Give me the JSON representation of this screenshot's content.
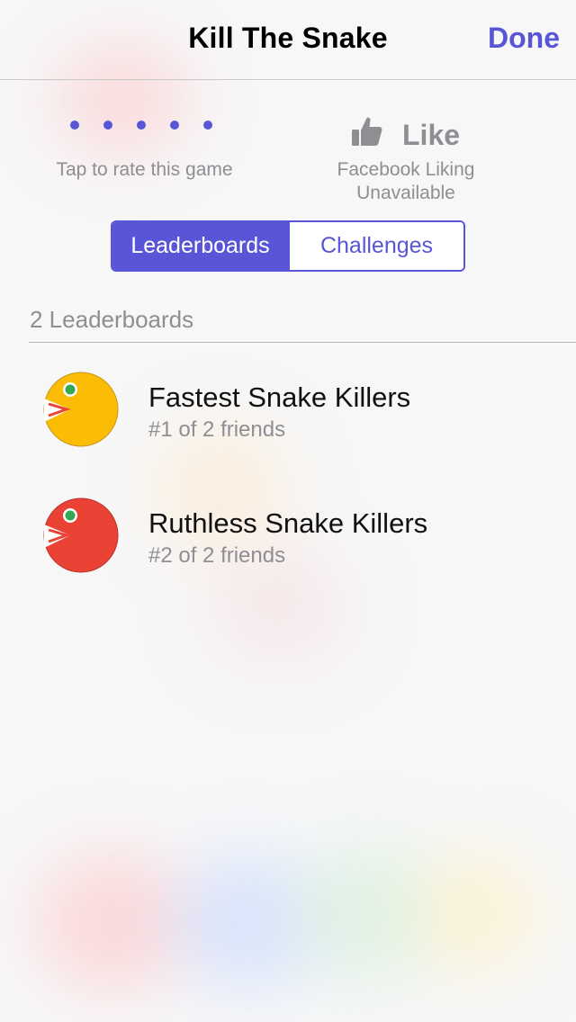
{
  "nav": {
    "title": "Kill The Snake",
    "done_label": "Done"
  },
  "rating": {
    "stars_filled": 0,
    "stars_total": 5,
    "label": "Tap to rate this game"
  },
  "facebook": {
    "like_label": "Like",
    "status_line1": "Facebook Liking",
    "status_line2": "Unavailable"
  },
  "segmented": {
    "tabs": [
      {
        "label": "Leaderboards",
        "selected": true
      },
      {
        "label": "Challenges",
        "selected": false
      }
    ]
  },
  "leaderboards": {
    "header": "2 Leaderboards",
    "items": [
      {
        "title": "Fastest Snake Killers",
        "subtitle": "#1 of 2 friends",
        "icon": "snake-face-icon",
        "icon_color": "#fbbc05"
      },
      {
        "title": "Ruthless Snake Killers",
        "subtitle": "#2 of 2 friends",
        "icon": "snake-face-icon",
        "icon_color": "#ea4335"
      }
    ]
  },
  "colors": {
    "accent": "#5856d6",
    "secondary_text": "#8e8e93"
  }
}
